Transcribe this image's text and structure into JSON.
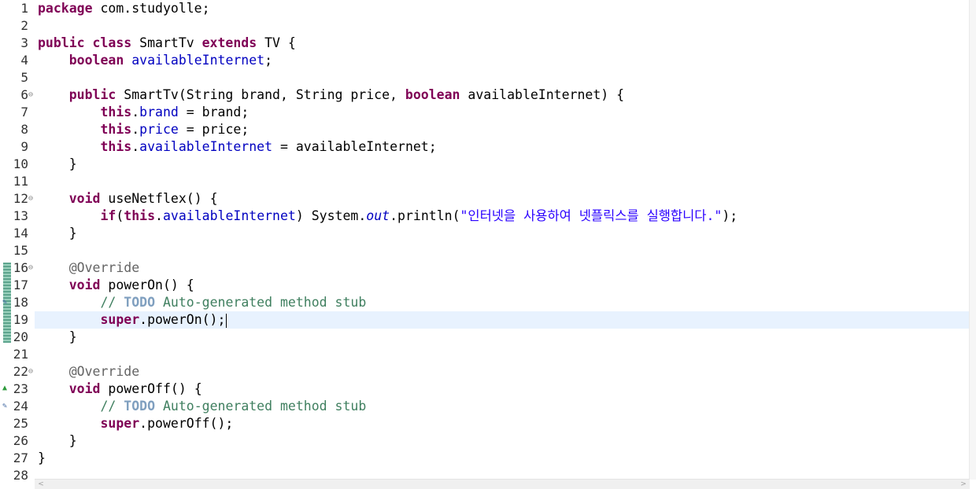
{
  "editor": {
    "current_line": 19,
    "lines": [
      {
        "n": "1",
        "segs": [
          [
            "kw",
            "package"
          ],
          [
            "plain",
            " com.studyolle;"
          ]
        ]
      },
      {
        "n": "2",
        "segs": []
      },
      {
        "n": "3",
        "segs": [
          [
            "kw",
            "public"
          ],
          [
            "plain",
            " "
          ],
          [
            "kw",
            "class"
          ],
          [
            "plain",
            " SmartTv "
          ],
          [
            "kw",
            "extends"
          ],
          [
            "plain",
            " TV {"
          ]
        ]
      },
      {
        "n": "4",
        "segs": [
          [
            "plain",
            "    "
          ],
          [
            "kw",
            "boolean"
          ],
          [
            "plain",
            " "
          ],
          [
            "field",
            "availableInternet"
          ],
          [
            "plain",
            ";"
          ]
        ]
      },
      {
        "n": "5",
        "segs": []
      },
      {
        "n": "6",
        "fold": "⊖",
        "segs": [
          [
            "plain",
            "    "
          ],
          [
            "kw",
            "public"
          ],
          [
            "plain",
            " SmartTv(String brand, String price, "
          ],
          [
            "kw",
            "boolean"
          ],
          [
            "plain",
            " availableInternet) {"
          ]
        ]
      },
      {
        "n": "7",
        "segs": [
          [
            "plain",
            "        "
          ],
          [
            "kw",
            "this"
          ],
          [
            "plain",
            "."
          ],
          [
            "field",
            "brand"
          ],
          [
            "plain",
            " = brand;"
          ]
        ]
      },
      {
        "n": "8",
        "segs": [
          [
            "plain",
            "        "
          ],
          [
            "kw",
            "this"
          ],
          [
            "plain",
            "."
          ],
          [
            "field",
            "price"
          ],
          [
            "plain",
            " = price;"
          ]
        ]
      },
      {
        "n": "9",
        "segs": [
          [
            "plain",
            "        "
          ],
          [
            "kw",
            "this"
          ],
          [
            "plain",
            "."
          ],
          [
            "field",
            "availableInternet"
          ],
          [
            "plain",
            " = availableInternet;"
          ]
        ]
      },
      {
        "n": "10",
        "segs": [
          [
            "plain",
            "    }"
          ]
        ]
      },
      {
        "n": "11",
        "segs": []
      },
      {
        "n": "12",
        "fold": "⊖",
        "segs": [
          [
            "plain",
            "    "
          ],
          [
            "kw",
            "void"
          ],
          [
            "plain",
            " useNetflex() {"
          ]
        ]
      },
      {
        "n": "13",
        "segs": [
          [
            "plain",
            "        "
          ],
          [
            "kw",
            "if"
          ],
          [
            "plain",
            "("
          ],
          [
            "kw",
            "this"
          ],
          [
            "plain",
            "."
          ],
          [
            "field",
            "availableInternet"
          ],
          [
            "plain",
            ") System."
          ],
          [
            "static",
            "out"
          ],
          [
            "plain",
            ".println("
          ],
          [
            "str",
            "\"인터넷을 사용하여 넷플릭스를 실행합니다.\""
          ],
          [
            "plain",
            ");"
          ]
        ]
      },
      {
        "n": "14",
        "segs": [
          [
            "plain",
            "    }"
          ]
        ]
      },
      {
        "n": "15",
        "segs": []
      },
      {
        "n": "16",
        "fold": "⊖",
        "segs": [
          [
            "plain",
            "    "
          ],
          [
            "ann-kw",
            "@Override"
          ]
        ]
      },
      {
        "n": "17",
        "segs": [
          [
            "plain",
            "    "
          ],
          [
            "kw",
            "void"
          ],
          [
            "plain",
            " powerOn() {"
          ]
        ]
      },
      {
        "n": "18",
        "segs": [
          [
            "plain",
            "        "
          ],
          [
            "com",
            "// "
          ],
          [
            "todo",
            "TODO"
          ],
          [
            "com",
            " Auto-generated method stub"
          ]
        ]
      },
      {
        "n": "19",
        "segs": [
          [
            "plain",
            "        "
          ],
          [
            "kw",
            "super"
          ],
          [
            "plain",
            ".powerOn();"
          ]
        ]
      },
      {
        "n": "20",
        "segs": [
          [
            "plain",
            "    }"
          ]
        ]
      },
      {
        "n": "21",
        "segs": []
      },
      {
        "n": "22",
        "fold": "⊖",
        "segs": [
          [
            "plain",
            "    "
          ],
          [
            "ann-kw",
            "@Override"
          ]
        ]
      },
      {
        "n": "23",
        "segs": [
          [
            "plain",
            "    "
          ],
          [
            "kw",
            "void"
          ],
          [
            "plain",
            " powerOff() {"
          ]
        ]
      },
      {
        "n": "24",
        "segs": [
          [
            "plain",
            "        "
          ],
          [
            "com",
            "// "
          ],
          [
            "todo",
            "TODO"
          ],
          [
            "com",
            " Auto-generated method stub"
          ]
        ]
      },
      {
        "n": "25",
        "segs": [
          [
            "plain",
            "        "
          ],
          [
            "kw",
            "super"
          ],
          [
            "plain",
            ".powerOff();"
          ]
        ]
      },
      {
        "n": "26",
        "segs": [
          [
            "plain",
            "    }"
          ]
        ]
      },
      {
        "n": "27",
        "segs": [
          [
            "plain",
            "}"
          ]
        ]
      },
      {
        "n": "28",
        "segs": []
      }
    ]
  },
  "icons": {
    "override_marker": "override-triangle-icon",
    "task_marker": "task-marker-icon",
    "fold": "fold-collapse-icon",
    "scroll_left": "scroll-left-icon",
    "scroll_right": "scroll-right-icon"
  },
  "colors": {
    "keyword": "#7f0055",
    "field": "#0000c0",
    "string": "#2a00ff",
    "comment": "#3f7f5f",
    "current_line_bg": "#e8f2fe",
    "change_marker": "#7bb7a0"
  }
}
